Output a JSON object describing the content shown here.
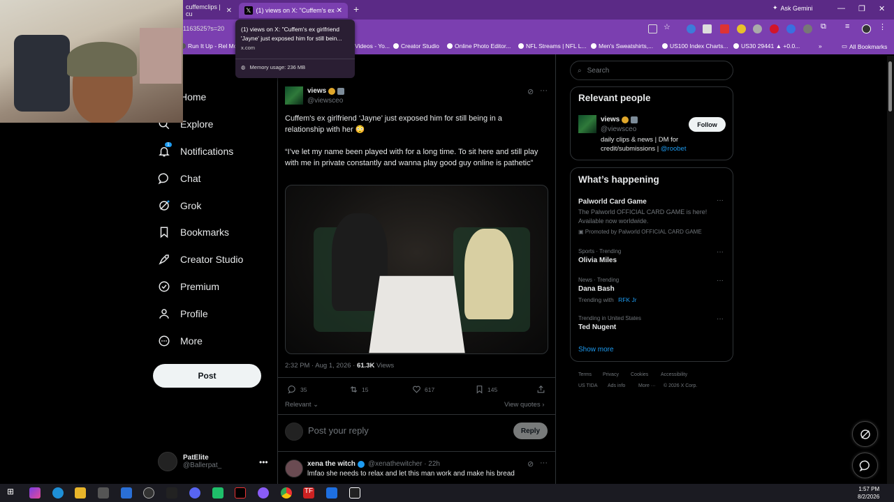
{
  "browser": {
    "tabs": [
      {
        "label": "cuffemclips | cu"
      },
      {
        "label": "(1) views on X: \"Cuffem's ex girl"
      }
    ],
    "new_tab": "+",
    "ask_gemini": "Ask Gemini",
    "url_fragment": "1163525?s=20",
    "bookmarks": [
      "Run It Up - Rel Mor",
      "Videos - Yo...",
      "Creator Studio",
      "Online Photo Editor...",
      "NFL Streams | NFL L...",
      "Men's Sweatshirts,...",
      "US100 Index Charts...",
      "US30 29441 ▲ +0.0..."
    ],
    "all_bookmarks": "All Bookmarks",
    "tooltip": {
      "title": "(1) views on X: \"Cuffem's ex girlfriend 'Jayne' just exposed him for still bein...",
      "url": "x.com",
      "memory": "Memory usage: 236 MB"
    }
  },
  "nav": {
    "items": [
      {
        "label": "Home"
      },
      {
        "label": "Explore"
      },
      {
        "label": "Notifications"
      },
      {
        "label": "Chat"
      },
      {
        "label": "Grok"
      },
      {
        "label": "Bookmarks"
      },
      {
        "label": "Creator Studio"
      },
      {
        "label": "Premium"
      },
      {
        "label": "Profile"
      },
      {
        "label": "More"
      }
    ],
    "notif_badge": "1",
    "post_label": "Post",
    "me": {
      "name": "PatElite",
      "handle": "@Ballerpat_"
    }
  },
  "tweet": {
    "author": "views",
    "handle": "@viewsceo",
    "text1": "Cuffem's ex girlfriend ‘Jayne’ just exposed him for still being in a relationship with her 😳",
    "text2": "“I’ve let my name been played with for a long time. To sit here and still play with me in private constantly and wanna play good guy online is pathetic”",
    "time": "2:32 PM · Aug 1, 2026 ·",
    "views_count": "61.3K",
    "views_label": "Views",
    "replies": "35",
    "reposts": "15",
    "likes": "617",
    "bookmarks": "145",
    "relevant": "Relevant",
    "view_quotes": "View quotes",
    "reply_placeholder": "Post your reply",
    "reply_btn": "Reply"
  },
  "reply": {
    "author": "xena the witch",
    "handle": "@xenathewitcher · 22h",
    "text": "lmfao she needs to relax and let this man work and make his bread"
  },
  "right": {
    "search_placeholder": "Search",
    "relevant_title": "Relevant people",
    "person": {
      "name": "views",
      "handle": "@viewsceo",
      "follow": "Follow",
      "bio": "daily clips & news | DM for credit/submissions |",
      "bio_link": "@roobet"
    },
    "happening_title": "What’s happening",
    "trends": [
      {
        "cat": "",
        "name": "Palworld Card Game",
        "sub": "The Palworld OFFICIAL CARD GAME is here! Available now worldwide.",
        "promo": "Promoted by Palworld OFFICIAL CARD GAME"
      },
      {
        "cat": "Sports · Trending",
        "name": "Olivia Miles"
      },
      {
        "cat": "News · Trending",
        "name": "Dana Bash",
        "trending_with": "Trending with",
        "with_link": "RFK Jr"
      },
      {
        "cat": "Trending in United States",
        "name": "Ted Nugent"
      }
    ],
    "show_more": "Show more",
    "footer": [
      "Terms",
      "Privacy",
      "Cookies",
      "Accessibility",
      "US TIDA",
      "Ads info",
      "More ···",
      "© 2026 X Corp."
    ]
  },
  "taskbar": {
    "time": "1:57 PM",
    "date": "8/2/2026"
  },
  "colors": {
    "accent": "#1d9bf0",
    "chrome": "#7b3fb0",
    "gold": "#e0a72b"
  }
}
